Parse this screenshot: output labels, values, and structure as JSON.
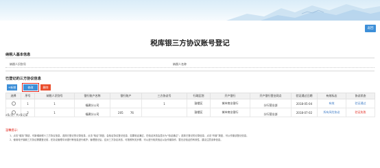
{
  "header": {
    "back_label": "返回"
  },
  "page_title": "税库银三方协议账号登记",
  "taxpayer_section": {
    "title": "纳税人基本信息",
    "id_label": "纳税人识别号",
    "name_label": "纳税人名称"
  },
  "agreement_section": {
    "title": "已登记的三方协议信息",
    "buttons": {
      "add": "+新增",
      "modify": "修改",
      "delete": "删除"
    },
    "columns": [
      "选择",
      "序号",
      "纳税人识别号",
      "银行账户名称",
      "银行账户",
      "三方协议号",
      "行政区划",
      "开户银行",
      "开户银行营业网点",
      "验证通过日期",
      "有效标志",
      "协议状态"
    ],
    "rows": [
      {
        "seq": "1",
        "taxpayer_id": "1",
        "account_name": "福建分公司",
        "account_no": "",
        "protocol_no": "1",
        "region": "鼓楼区",
        "bank": "城市商业银行",
        "branch": "分行营业部",
        "verify_date": "2018-05-04",
        "valid": "有效",
        "status": "验证通过"
      },
      {
        "seq": "2",
        "taxpayer_id": "1",
        "account_name": "福建分公司",
        "account_no": "205",
        "account_tail": "76",
        "protocol_no": "",
        "region": "鼓楼区",
        "bank": "城市商业银行",
        "branch": "分行营业部",
        "verify_date": "2018-07-02",
        "valid": "所有风险协议",
        "status": "验证失败"
      }
    ],
    "pager_text": "4条/页，共2条记录"
  },
  "tips": {
    "title": "温馨提示：",
    "items": [
      "1、点击“增加”按钮，可新增纳税人三方协议信息，选择已登记的记录信息，点击“验证”按钮，会验证协议登记信息，如果验证通过，在验证状态会显示为“验证通过”；选择已登记的记录信息，点击“作废”按钮，可以作废该登记信息。",
      "2、使用电子缴款三方协议需要登记前，在协议管理中对银行等信息进行维护；管理登记后，应对三方协议状态，可按照有关步骤，可以进行相关验证以及作废操作，暂无法验证的有效性，建议注意该条信息。"
    ]
  },
  "colors": {
    "accent": "#3d8fd8",
    "danger": "#e1261c",
    "link": "#3a78c4"
  }
}
